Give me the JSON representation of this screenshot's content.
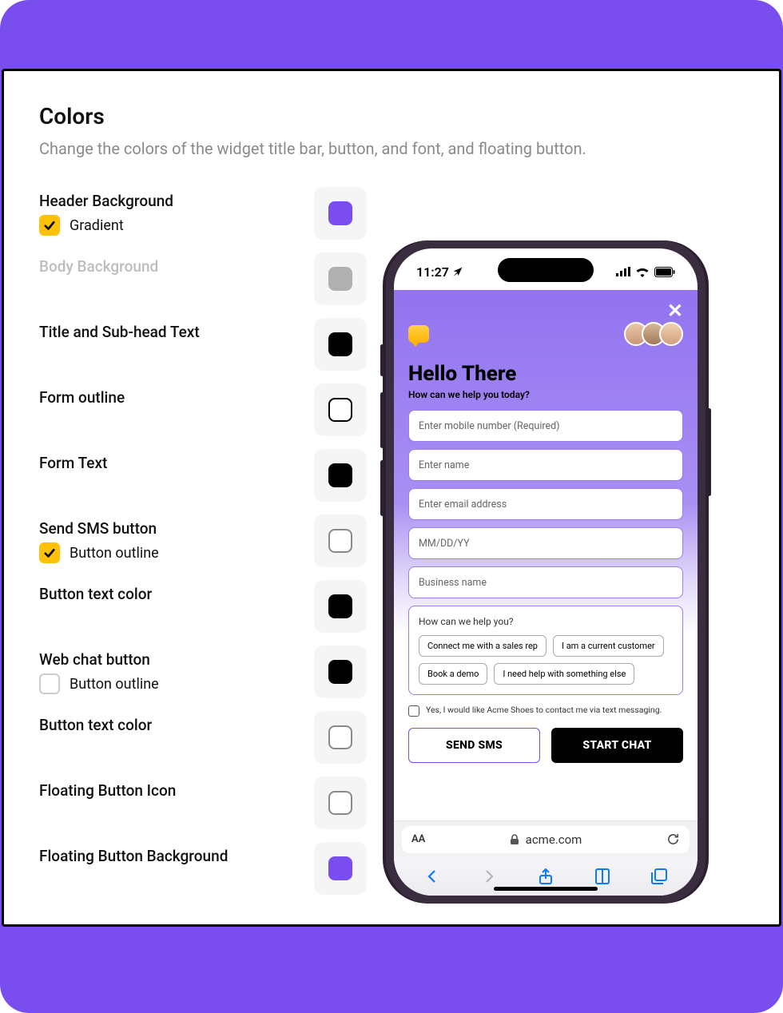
{
  "section": {
    "title": "Colors",
    "subtitle": "Change the colors of the widget title bar, button, and font, and floating button."
  },
  "settings": [
    {
      "label": "Header Background",
      "sub": {
        "checked": true,
        "label": "Gradient"
      },
      "swatch": "sw-purple"
    },
    {
      "label": "Body Background",
      "muted": true,
      "swatch": "sw-grey"
    },
    {
      "label": "Title and Sub-head Text",
      "swatch": "sw-black"
    },
    {
      "label": "Form outline",
      "swatch": "sw-outline"
    },
    {
      "label": "Form Text",
      "swatch": "sw-black"
    },
    {
      "label": "Send SMS button",
      "sub": {
        "checked": true,
        "label": "Button outline"
      },
      "swatch": "sw-outline-grey"
    },
    {
      "label": "Button text color",
      "swatch": "sw-black"
    },
    {
      "label": "Web chat button",
      "sub": {
        "checked": false,
        "label": "Button outline"
      },
      "swatch": "sw-black"
    },
    {
      "label": "Button text color",
      "swatch": "sw-outline-grey"
    },
    {
      "label": "Floating Button Icon",
      "swatch": "sw-outline-grey"
    },
    {
      "label": "Floating Button Background",
      "swatch": "sw-purple"
    }
  ],
  "phone": {
    "status_time": "11:27",
    "widget": {
      "title": "Hello There",
      "subtitle": "How can we help you today?",
      "fields": {
        "mobile": "Enter mobile number (Required)",
        "name": "Enter name",
        "email": "Enter email address",
        "date": "MM/DD/YY",
        "business": "Business name"
      },
      "options_question": "How can we help you?",
      "options": [
        "Connect me with a sales rep",
        "I am a current customer",
        "Book a demo",
        "I need help with something else"
      ],
      "consent": "Yes, I would like Acme Shoes to contact me via text messaging.",
      "send_sms": "SEND SMS",
      "start_chat": "START CHAT"
    },
    "url_aa": "AA",
    "url_host": "acme.com"
  }
}
